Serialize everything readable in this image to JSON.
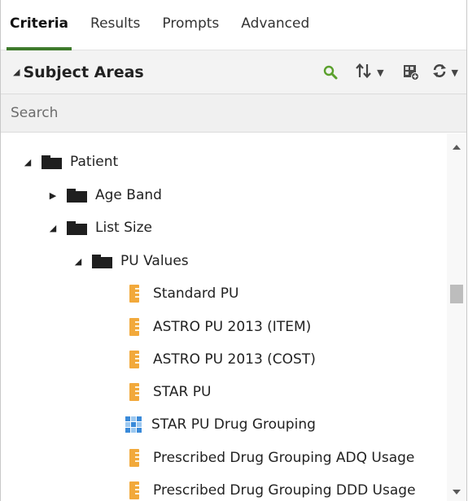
{
  "tabs": [
    "Criteria",
    "Results",
    "Prompts",
    "Advanced"
  ],
  "panel": {
    "title": "Subject Areas",
    "collapse_icon": "triangle-down-icon"
  },
  "toolbar": {
    "search": "search-icon",
    "sort": "sort-icon",
    "new_table": "new-table-icon",
    "refresh": "refresh-icon"
  },
  "search": {
    "placeholder": "Search",
    "value": ""
  },
  "tree": [
    {
      "label": "Patient",
      "kind": "folder",
      "expanded": true
    },
    {
      "label": "Age Band",
      "kind": "folder",
      "expanded": false
    },
    {
      "label": "List Size",
      "kind": "folder",
      "expanded": true
    },
    {
      "label": "PU Values",
      "kind": "folder",
      "expanded": true
    },
    {
      "label": "Standard PU",
      "kind": "measure"
    },
    {
      "label": "ASTRO PU 2013 (ITEM)",
      "kind": "measure"
    },
    {
      "label": "ASTRO PU 2013 (COST)",
      "kind": "measure"
    },
    {
      "label": "STAR PU",
      "kind": "measure"
    },
    {
      "label": "STAR PU Drug Grouping",
      "kind": "hierarchy"
    },
    {
      "label": "Prescribed Drug Grouping ADQ Usage",
      "kind": "measure"
    },
    {
      "label": "Prescribed Drug Grouping DDD Usage",
      "kind": "measure"
    }
  ],
  "colors": {
    "active_tab_underline": "#3e7a2c",
    "search_icon": "#5aa02c",
    "measure_icon": "#f2a93b",
    "hierarchy_icon": "#3a8ad9"
  }
}
